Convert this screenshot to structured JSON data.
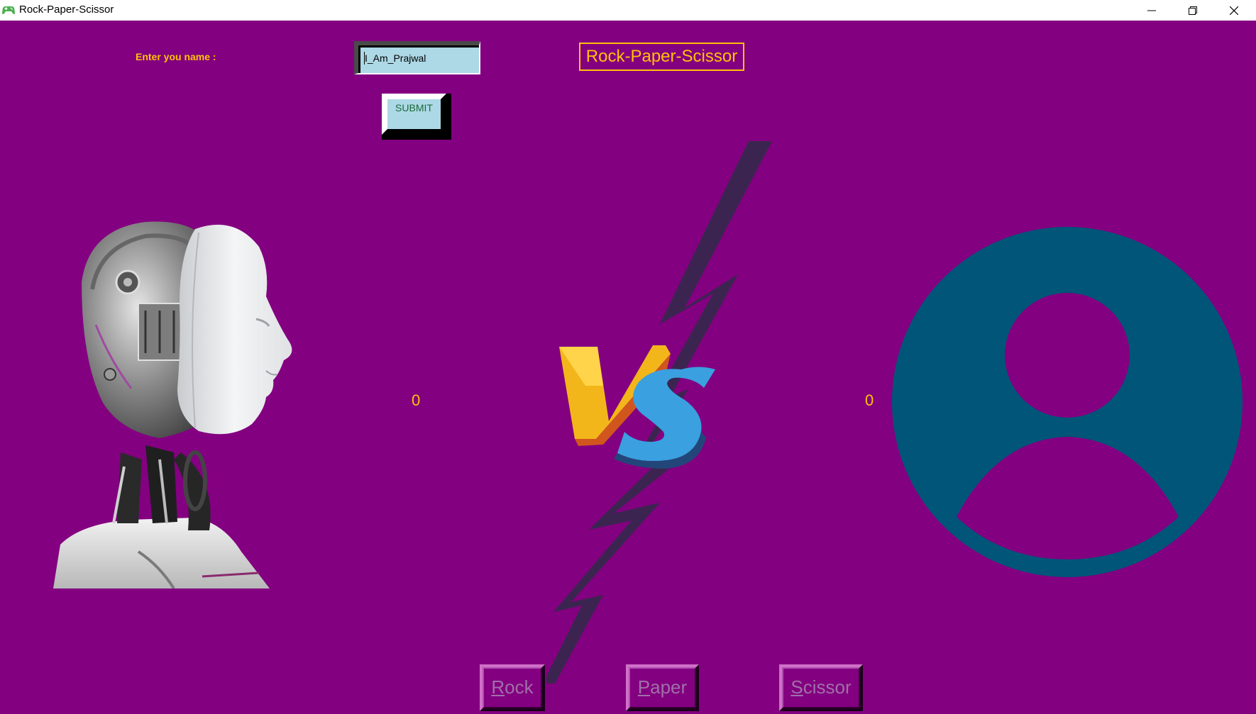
{
  "window": {
    "title": "Rock-Paper-Scissor",
    "icon": "gamepad-icon",
    "controls": [
      "minimize-icon",
      "restore-icon",
      "close-icon"
    ]
  },
  "form": {
    "name_label": "Enter you name :",
    "name_value": "I_Am_Prajwal",
    "submit_label": "SUBMIT"
  },
  "game_title": "Rock-Paper-Scissor",
  "scores": {
    "computer": "0",
    "player": "0"
  },
  "images": {
    "computer": "robot-head-image",
    "versus": "vs-lightning-image",
    "player": "user-avatar-icon"
  },
  "moves": [
    {
      "label": "Rock",
      "mnemonic": "R",
      "rest": "ock"
    },
    {
      "label": "Paper",
      "mnemonic": "P",
      "rest": "aper"
    },
    {
      "label": "Scissor",
      "mnemonic": "S",
      "rest": "cissor"
    }
  ],
  "colors": {
    "background": "#830080",
    "accent": "#ffc107",
    "input_bg": "#add8e6",
    "avatar": "#005578"
  }
}
